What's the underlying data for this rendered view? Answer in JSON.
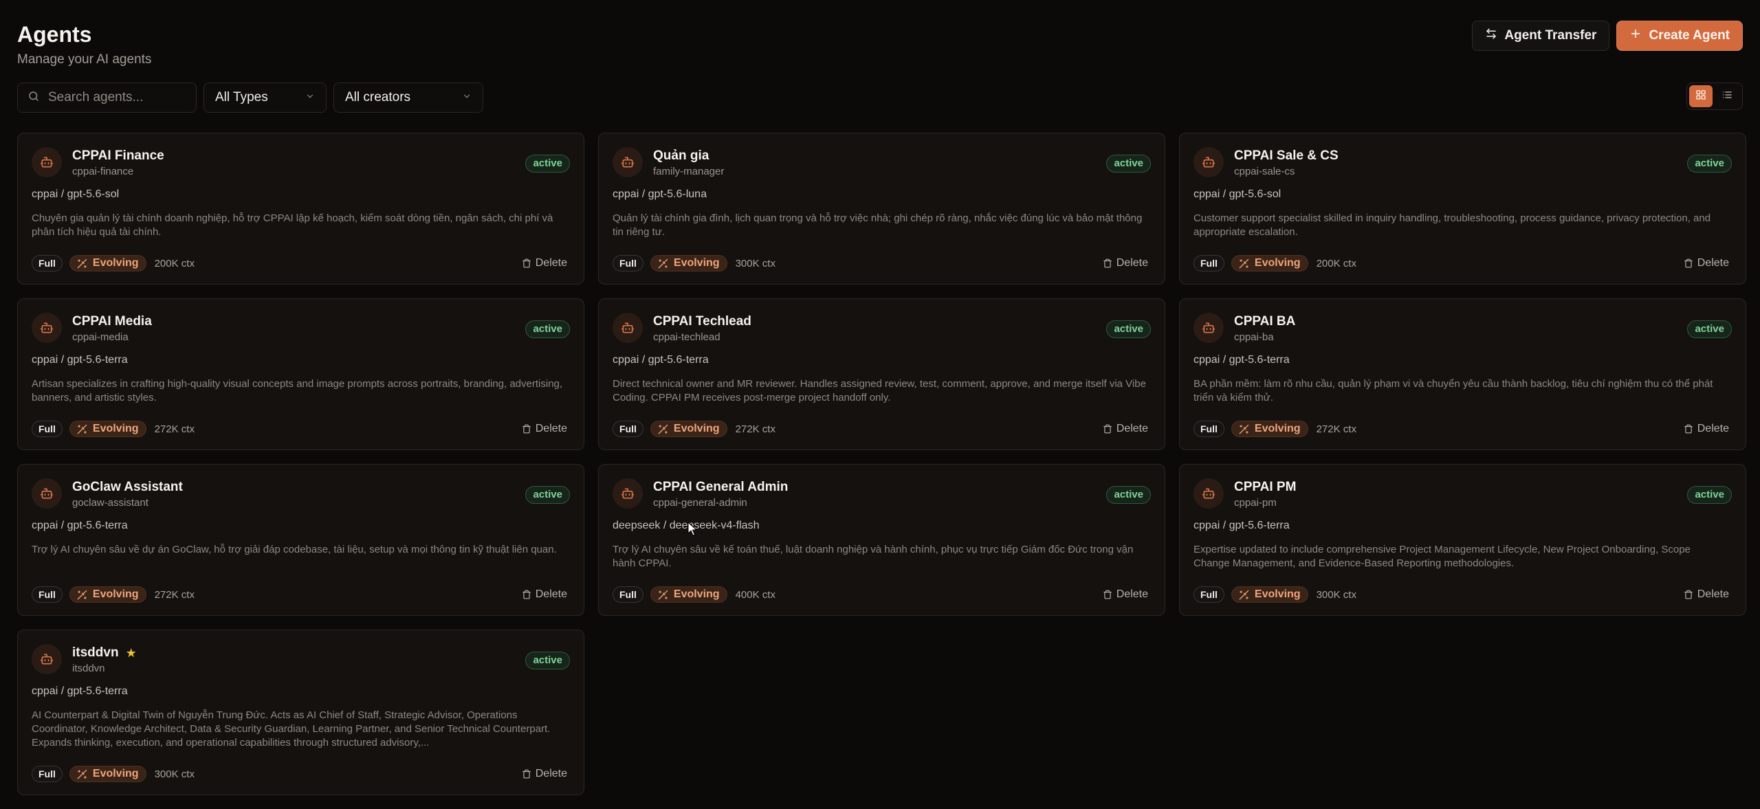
{
  "header": {
    "title": "Agents",
    "subtitle": "Manage your AI agents",
    "transfer_label": "Agent Transfer",
    "create_label": "Create Agent"
  },
  "filters": {
    "search_placeholder": "Search agents...",
    "types_value": "All Types",
    "creators_value": "All creators",
    "view_mode": "grid"
  },
  "colors": {
    "accent": "#d26a3e",
    "active_text": "#7fd49a",
    "evolving_text": "#f0a57c",
    "star": "#f2c033"
  },
  "agents": [
    {
      "name": "CPPAI Finance",
      "slug": "cppai-finance",
      "status": "active",
      "model": "cppai / gpt-5.6-sol",
      "description": "Chuyên gia quản lý tài chính doanh nghiệp, hỗ trợ CPPAI lập kế hoạch, kiểm soát dòng tiền, ngân sách, chi phí và phân tích hiệu quả tài chính.",
      "access": "Full",
      "evolution": "Evolving",
      "context": "200K ctx",
      "delete_label": "Delete",
      "starred": false
    },
    {
      "name": "Quản gia",
      "slug": "family-manager",
      "status": "active",
      "model": "cppai / gpt-5.6-luna",
      "description": "Quản lý tài chính gia đình, lịch quan trọng và hỗ trợ việc nhà; ghi chép rõ ràng, nhắc việc đúng lúc và bảo mật thông tin riêng tư.",
      "access": "Full",
      "evolution": "Evolving",
      "context": "300K ctx",
      "delete_label": "Delete",
      "starred": false
    },
    {
      "name": "CPPAI Sale & CS",
      "slug": "cppai-sale-cs",
      "status": "active",
      "model": "cppai / gpt-5.6-sol",
      "description": "Customer support specialist skilled in inquiry handling, troubleshooting, process guidance, privacy protection, and appropriate escalation.",
      "access": "Full",
      "evolution": "Evolving",
      "context": "200K ctx",
      "delete_label": "Delete",
      "starred": false
    },
    {
      "name": "CPPAI Media",
      "slug": "cppai-media",
      "status": "active",
      "model": "cppai / gpt-5.6-terra",
      "description": "Artisan specializes in crafting high-quality visual concepts and image prompts across portraits, branding, advertising, banners, and artistic styles.",
      "access": "Full",
      "evolution": "Evolving",
      "context": "272K ctx",
      "delete_label": "Delete",
      "starred": false
    },
    {
      "name": "CPPAI Techlead",
      "slug": "cppai-techlead",
      "status": "active",
      "model": "cppai / gpt-5.6-terra",
      "description": "Direct technical owner and MR reviewer. Handles assigned review, test, comment, approve, and merge itself via Vibe Coding. CPPAI PM receives post-merge project handoff only.",
      "access": "Full",
      "evolution": "Evolving",
      "context": "272K ctx",
      "delete_label": "Delete",
      "starred": false
    },
    {
      "name": "CPPAI BA",
      "slug": "cppai-ba",
      "status": "active",
      "model": "cppai / gpt-5.6-terra",
      "description": "BA phần mềm: làm rõ nhu cầu, quản lý phạm vi và chuyển yêu cầu thành backlog, tiêu chí nghiệm thu có thể phát triển và kiểm thử.",
      "access": "Full",
      "evolution": "Evolving",
      "context": "272K ctx",
      "delete_label": "Delete",
      "starred": false
    },
    {
      "name": "GoClaw Assistant",
      "slug": "goclaw-assistant",
      "status": "active",
      "model": "cppai / gpt-5.6-terra",
      "description": "Trợ lý AI chuyên sâu về dự án GoClaw, hỗ trợ giải đáp codebase, tài liệu, setup và mọi thông tin kỹ thuật liên quan.",
      "access": "Full",
      "evolution": "Evolving",
      "context": "272K ctx",
      "delete_label": "Delete",
      "starred": false
    },
    {
      "name": "CPPAI General Admin",
      "slug": "cppai-general-admin",
      "status": "active",
      "model": "deepseek / deepseek-v4-flash",
      "description": "Trợ lý AI chuyên sâu về kế toán thuế, luật doanh nghiệp và hành chính, phục vụ trực tiếp Giám đốc Đức trong vận hành CPPAI.",
      "access": "Full",
      "evolution": "Evolving",
      "context": "400K ctx",
      "delete_label": "Delete",
      "starred": false
    },
    {
      "name": "CPPAI PM",
      "slug": "cppai-pm",
      "status": "active",
      "model": "cppai / gpt-5.6-terra",
      "description": "Expertise updated to include comprehensive Project Management Lifecycle, New Project Onboarding, Scope Change Management, and Evidence-Based Reporting methodologies.",
      "access": "Full",
      "evolution": "Evolving",
      "context": "300K ctx",
      "delete_label": "Delete",
      "starred": false
    },
    {
      "name": "itsddvn",
      "slug": "itsddvn",
      "status": "active",
      "model": "cppai / gpt-5.6-terra",
      "description": "AI Counterpart & Digital Twin of Nguyễn Trung Đức. Acts as AI Chief of Staff, Strategic Advisor, Operations Coordinator, Knowledge Architect, Data & Security Guardian, Learning Partner, and Senior Technical Counterpart. Expands thinking, execution, and operational capabilities through structured advisory,...",
      "access": "Full",
      "evolution": "Evolving",
      "context": "300K ctx",
      "delete_label": "Delete",
      "starred": true
    }
  ]
}
